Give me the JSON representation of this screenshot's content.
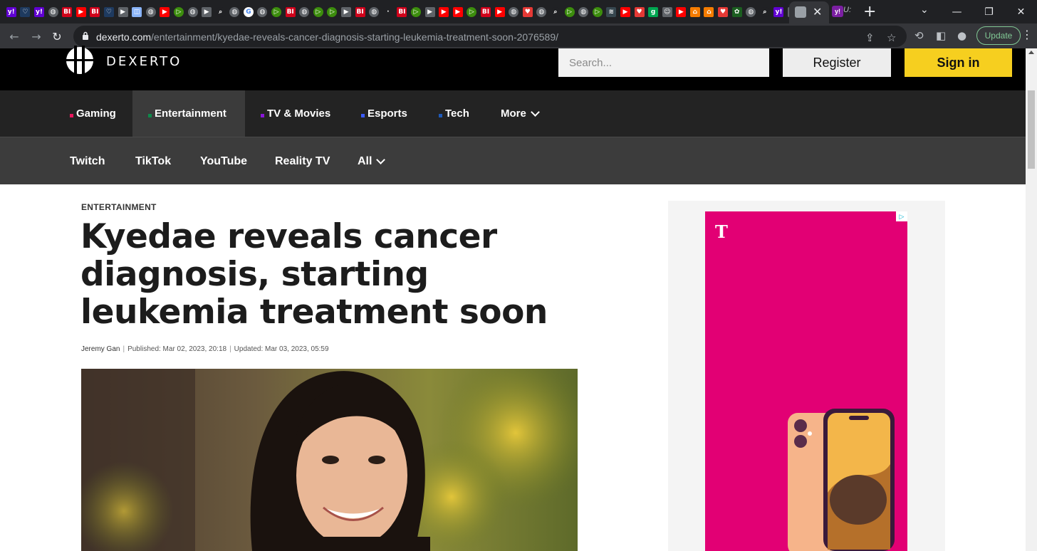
{
  "browser": {
    "tab_favicons": [
      {
        "glyph": "y!",
        "bg": "#6001d2",
        "shape": "square"
      },
      {
        "glyph": "♡",
        "bg": "#1e3a5f",
        "shape": "square"
      },
      {
        "glyph": "y!",
        "bg": "#6001d2",
        "shape": "square"
      },
      {
        "glyph": "◍",
        "bg": "#5f6368",
        "shape": "round"
      },
      {
        "glyph": "BI",
        "bg": "#d0021b",
        "shape": "square"
      },
      {
        "glyph": "▶",
        "bg": "#ff0000",
        "shape": "square"
      },
      {
        "glyph": "BI",
        "bg": "#d0021b",
        "shape": "square"
      },
      {
        "glyph": "♡",
        "bg": "#1e3a5f",
        "shape": "square"
      },
      {
        "glyph": "▶",
        "bg": "#5f6368",
        "shape": "square"
      },
      {
        "glyph": "◫",
        "bg": "#8ab4f8",
        "shape": "square"
      },
      {
        "glyph": "◍",
        "bg": "#5f6368",
        "shape": "round"
      },
      {
        "glyph": "▶",
        "bg": "#ff0000",
        "shape": "square"
      },
      {
        "glyph": "▷",
        "bg": "#3c8d0d",
        "shape": "round"
      },
      {
        "glyph": "◍",
        "bg": "#5f6368",
        "shape": "round"
      },
      {
        "glyph": "▶",
        "bg": "#5f6368",
        "shape": "square"
      },
      {
        "glyph": "⌕",
        "bg": "#202124",
        "shape": "round"
      },
      {
        "glyph": "◍",
        "bg": "#5f6368",
        "shape": "round"
      },
      {
        "glyph": "G",
        "bg": "#ffffff",
        "shape": "round"
      },
      {
        "glyph": "◍",
        "bg": "#5f6368",
        "shape": "round"
      },
      {
        "glyph": "▷",
        "bg": "#3c8d0d",
        "shape": "round"
      },
      {
        "glyph": "BI",
        "bg": "#d0021b",
        "shape": "square"
      },
      {
        "glyph": "◍",
        "bg": "#5f6368",
        "shape": "round"
      },
      {
        "glyph": "▷",
        "bg": "#3c8d0d",
        "shape": "round"
      },
      {
        "glyph": "▷",
        "bg": "#3c8d0d",
        "shape": "round"
      },
      {
        "glyph": "▶",
        "bg": "#5f6368",
        "shape": "square"
      },
      {
        "glyph": "BI",
        "bg": "#d0021b",
        "shape": "square"
      },
      {
        "glyph": "◍",
        "bg": "#5f6368",
        "shape": "round"
      },
      {
        "glyph": "·",
        "bg": "#202124",
        "shape": "square"
      },
      {
        "glyph": "BI",
        "bg": "#d0021b",
        "shape": "square"
      },
      {
        "glyph": "▷",
        "bg": "#3c8d0d",
        "shape": "round"
      },
      {
        "glyph": "▶",
        "bg": "#5f6368",
        "shape": "square"
      },
      {
        "glyph": "▶",
        "bg": "#ff0000",
        "shape": "square"
      },
      {
        "glyph": "▶",
        "bg": "#ff0000",
        "shape": "square"
      },
      {
        "glyph": "▷",
        "bg": "#3c8d0d",
        "shape": "round"
      },
      {
        "glyph": "BI",
        "bg": "#d0021b",
        "shape": "square"
      },
      {
        "glyph": "▶",
        "bg": "#ff0000",
        "shape": "square"
      },
      {
        "glyph": "◍",
        "bg": "#5f6368",
        "shape": "round"
      },
      {
        "glyph": "♥",
        "bg": "#e53935",
        "shape": "square"
      },
      {
        "glyph": "◍",
        "bg": "#5f6368",
        "shape": "round"
      },
      {
        "glyph": "⌕",
        "bg": "#202124",
        "shape": "round"
      },
      {
        "glyph": "▷",
        "bg": "#3c8d0d",
        "shape": "round"
      },
      {
        "glyph": "◍",
        "bg": "#5f6368",
        "shape": "round"
      },
      {
        "glyph": "▷",
        "bg": "#3c8d0d",
        "shape": "round"
      },
      {
        "glyph": "≋",
        "bg": "#37474f",
        "shape": "square"
      },
      {
        "glyph": "▶",
        "bg": "#ff0000",
        "shape": "square"
      },
      {
        "glyph": "♥",
        "bg": "#e53935",
        "shape": "square"
      },
      {
        "glyph": "g",
        "bg": "#00a651",
        "shape": "square"
      },
      {
        "glyph": "☺",
        "bg": "#5f6368",
        "shape": "square"
      },
      {
        "glyph": "▶",
        "bg": "#ff0000",
        "shape": "square"
      },
      {
        "glyph": "⌂",
        "bg": "#f57c00",
        "shape": "square"
      },
      {
        "glyph": "⌂",
        "bg": "#f57c00",
        "shape": "square"
      },
      {
        "glyph": "♥",
        "bg": "#e53935",
        "shape": "square"
      },
      {
        "glyph": "✿",
        "bg": "#1b5e20",
        "shape": "square"
      },
      {
        "glyph": "◍",
        "bg": "#5f6368",
        "shape": "round"
      },
      {
        "glyph": "⌕",
        "bg": "#202124",
        "shape": "round"
      },
      {
        "glyph": "y!",
        "bg": "#6001d2",
        "shape": "square"
      },
      {
        "glyph": "☺",
        "bg": "#5f6368",
        "shape": "square"
      }
    ],
    "active_tab_close": "✕",
    "next_tab_favicon": "y!",
    "next_tab_glyph": "U:",
    "new_tab_label": "+",
    "url_host": "dexerto.com",
    "url_path": "/entertainment/kyedae-reveals-cancer-diagnosis-starting-leukemia-treatment-soon-2076589/",
    "update_label": "Update",
    "icons": [
      "back-icon",
      "forward-icon",
      "reload-icon",
      "lock-icon",
      "share-icon",
      "star-icon",
      "extension-icon",
      "sidebar-icon",
      "profile-icon",
      "menu-icon"
    ]
  },
  "site": {
    "logo_text": "DEXERTO",
    "search_placeholder": "Search...",
    "register_label": "Register",
    "signin_label": "Sign in",
    "accent_yellow": "#f6cf1f",
    "primary_nav": [
      {
        "label": "Gaming",
        "dot": "#e8175d"
      },
      {
        "label": "Entertainment",
        "dot": "#0d8a4a"
      },
      {
        "label": "TV & Movies",
        "dot": "#8a16d9"
      },
      {
        "label": "Esports",
        "dot": "#3b5bff"
      },
      {
        "label": "Tech",
        "dot": "#1f5ab8"
      },
      {
        "label": "More",
        "dot": ""
      }
    ],
    "secondary_nav": [
      "Twitch",
      "TikTok",
      "YouTube",
      "Reality TV",
      "All"
    ]
  },
  "article": {
    "category": "ENTERTAINMENT",
    "headline": "Kyedae reveals cancer diagnosis, starting leukemia treatment soon",
    "author": "Jeremy Gan",
    "published": "Published: Mar 02, 2023, 20:18",
    "updated": "Updated: Mar 03, 2023, 05:59"
  },
  "ad": {
    "brand_glyph": "T",
    "brand_color": "#e20074"
  }
}
